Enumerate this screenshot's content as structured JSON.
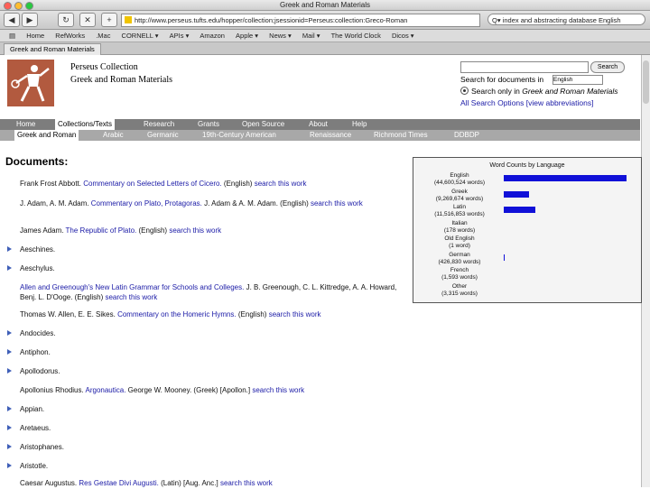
{
  "window": {
    "title": "Greek and Roman Materials"
  },
  "toolbar": {
    "back_glyph": "◀",
    "forward_glyph": "▶",
    "reload_glyph": "↻",
    "stop_glyph": "✕",
    "add_glyph": "+",
    "url": "http://www.perseus.tufts.edu/hopper/collection;jsessionid=Perseus:collection:Greco-Roman",
    "search_value": "Q▾ index and abstracting database English"
  },
  "bookmarks": [
    "Home",
    "RefWorks",
    ".Mac",
    "CORNELL ▾",
    "APIs ▾",
    "Amazon",
    "Apple ▾",
    "News ▾",
    "Mail ▾",
    "The World Clock",
    "Dicos ▾"
  ],
  "tabs": [
    {
      "label": "Greek and Roman Materials"
    }
  ],
  "header": {
    "site_name": "Perseus Collection",
    "site_subtitle": "Greek and Roman Materials"
  },
  "site_search": {
    "button_label": "Search",
    "search_for_label": "Search for documents in",
    "language_selected": "English",
    "search_only_prefix": "Search only in",
    "search_only_collection": "Greek and Roman Materials",
    "all_options": "All Search Options",
    "abbreviations": "[view abbreviations]"
  },
  "nav_primary": [
    {
      "label": "Home"
    },
    {
      "label": "Collections/Texts"
    },
    {
      "label": "Research"
    },
    {
      "label": "Grants"
    },
    {
      "label": "Open Source"
    },
    {
      "label": "About"
    },
    {
      "label": "Help"
    }
  ],
  "nav_secondary": [
    {
      "label": "Greek and Roman"
    },
    {
      "label": "Arabic"
    },
    {
      "label": "Germanic"
    },
    {
      "label": "19th-Century American"
    },
    {
      "label": "Renaissance"
    },
    {
      "label": "Richmond Times"
    },
    {
      "label": "DDBDP"
    }
  ],
  "documents": {
    "heading": "Documents:",
    "search_link": "search this work",
    "items": [
      {
        "author": "Frank Frost Abbott.",
        "title": "Commentary on Selected Letters of Cicero.",
        "lang": "(English)"
      },
      {
        "author": "J. Adam, A. M. Adam.",
        "title": "Commentary on Plato, Protagoras.",
        "lang": "J. Adam & A. M. Adam. (English)"
      },
      {
        "author": "James Adam.",
        "title": "The Republic of Plato.",
        "lang": "(English)"
      },
      {
        "author": "Aeschines."
      },
      {
        "author": "Aeschylus."
      },
      {
        "author": "",
        "title": "Allen and Greenough's New Latin Grammar for Schools and Colleges.",
        "lang": "J. B. Greenough, C. L. Kittredge, A. A. Howard, Benj. L. D'Ooge. (English)"
      },
      {
        "author": "Thomas W. Allen, E. E. Sikes.",
        "title": "Commentary on the Homeric Hymns.",
        "lang": "(English)"
      },
      {
        "author": "Andocides."
      },
      {
        "author": "Antiphon."
      },
      {
        "author": "Apollodorus."
      },
      {
        "author": "Apollonius Rhodius.",
        "title": "Argonautica.",
        "lang": "George W. Mooney. (Greek) [Apollon.]"
      },
      {
        "author": "Appian."
      },
      {
        "author": "Aretaeus."
      },
      {
        "author": "Aristophanes."
      },
      {
        "author": "Aristotle."
      },
      {
        "author": "Caesar Augustus.",
        "title": "Res Gestae Divi Augusti.",
        "lang": "(Latin) [Aug. Anc.]"
      }
    ]
  },
  "chart_data": {
    "type": "bar",
    "title": "Word Counts by Language",
    "categories": [
      "English",
      "Greek",
      "Latin",
      "Italian",
      "Old English",
      "German",
      "French",
      "Other"
    ],
    "count_labels": [
      "(44,600,524 words)",
      "(9,269,674 words)",
      "(11,516,853 words)",
      "(178 words)",
      "(1 word)",
      "(426,830 words)",
      "(1,593 words)",
      "(3,315 words)"
    ],
    "values": [
      44600524,
      9269674,
      11516853,
      178,
      1,
      426830,
      1593,
      3315
    ],
    "bar_color": "#1010d8"
  },
  "colors": {
    "nav_primary_bg": "#7d7d7d",
    "nav_secondary_bg": "#a8a8a8",
    "link": "#1a1aa6",
    "logo_bg": "#b25a3f"
  }
}
